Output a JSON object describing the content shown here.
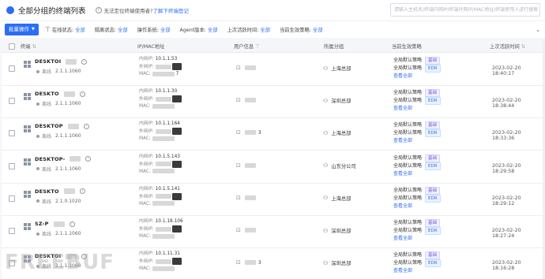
{
  "header": {
    "title": "全部分组的终端列表",
    "help_text": "无法定位终端使用者?",
    "help_link": "了解下终端登记",
    "search_placeholder": "请输入主机名/终端内网IP/终端外网IP/MAC地址/终端使用人进行搜索"
  },
  "filters": {
    "batch_label": "批量操作",
    "items": [
      {
        "label": "在线状态:",
        "value": "全部"
      },
      {
        "label": "隔离状态:",
        "value": "全部"
      },
      {
        "label": "操作系统:",
        "value": "全部"
      },
      {
        "label": "Agent版本:",
        "value": "全部"
      },
      {
        "label": "上次活跃时间:",
        "value": "全部"
      },
      {
        "label": "当前生效策略:",
        "value": "全部"
      }
    ]
  },
  "columns": {
    "terminal": "终端",
    "ipmac": "IP/MAC地址",
    "user": "用户信息",
    "group": "所属分组",
    "policy": "当前生效策略",
    "last_active": "上次活跃时间"
  },
  "labels": {
    "internal_ip": "内网IP:",
    "external_ip": "外网IP:",
    "mac": "MAC:",
    "status_offline": "离线",
    "policy_name": "全局默认策略",
    "tag_base": "基础",
    "tag_edr": "EDR",
    "view_all": "查看全部"
  },
  "rows": [
    {
      "hostname": "DESKTOI",
      "version": "2.1.1.1060",
      "internal_ip": "10.1.1.53",
      "mac_tail": "7",
      "user_tail": "",
      "group": "上海总部",
      "time": "2023-02-20 18:40:17"
    },
    {
      "hostname": "DESKTO",
      "version": "2.1.1.1060",
      "internal_ip": "10.1.1.30",
      "mac_tail": "",
      "user_tail": "",
      "group": "深圳总部",
      "time": "2023-02-20 18:38:44"
    },
    {
      "hostname": "DESKTOP",
      "version": "2.1.1.1060",
      "internal_ip": "10.1.1.164",
      "mac_tail": "",
      "user_tail": "3",
      "group": "上海总部",
      "time": "2023-02-20 18:33:36"
    },
    {
      "hostname": "DESKTOP-",
      "version": "2.1.1.1060",
      "internal_ip": "10.1.5.143",
      "mac_tail": "",
      "user_tail": "",
      "group": "山东分公司",
      "time": "2023-02-20 18:29:58"
    },
    {
      "hostname": "DESKTO",
      "version": "2.1.0.1020",
      "internal_ip": "10.1.5.141",
      "mac_tail": "",
      "user_tail": "",
      "group": "上海总部",
      "time": "2023-02-20 18:29:12"
    },
    {
      "hostname": "SZ-P",
      "version": "2.1.1.1060",
      "internal_ip": "10.1.18.106",
      "mac_tail": "",
      "user_tail": "",
      "group": "深圳总部",
      "time": "2023-02-20 18:27:24"
    },
    {
      "hostname": "DESKTOI",
      "version": "2.1.1.1060",
      "internal_ip": "10.1.11.31",
      "mac_tail": "",
      "user_tail": "3",
      "group": "深圳总部",
      "time": "2023-02-20 18:16:28"
    }
  ],
  "watermark": "FREEBUF",
  "colors": {
    "accent": "#2d6df6",
    "tag_base": "#6c5ce7"
  }
}
